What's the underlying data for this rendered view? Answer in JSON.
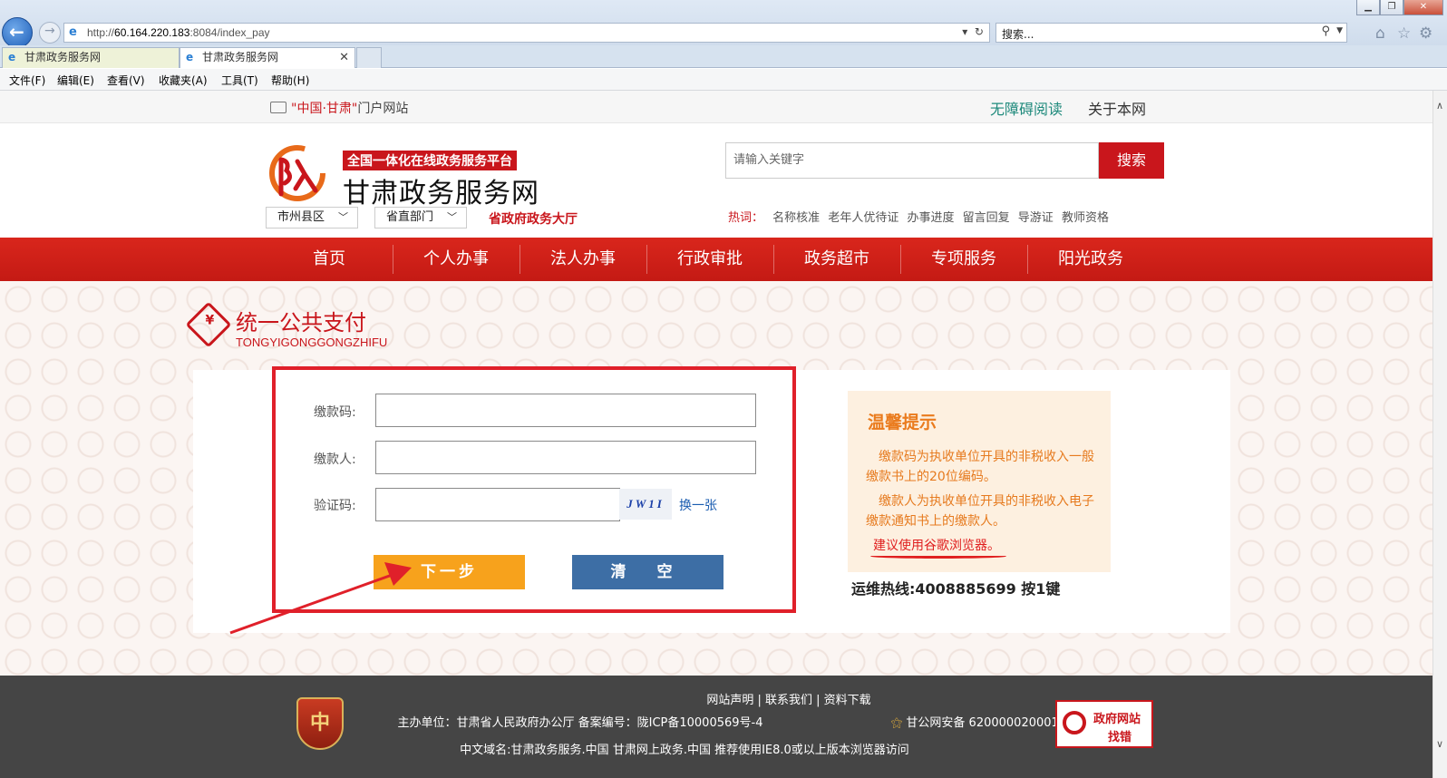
{
  "browser": {
    "url_prefix": "http://",
    "url_host": "60.164.220.183",
    "url_rest": ":8084/index_pay",
    "search_placeholder": "搜索...",
    "tabs": [
      {
        "label": "甘肃政务服务网"
      },
      {
        "label": "甘肃政务服务网"
      }
    ],
    "menu": [
      "文件(F)",
      "编辑(E)",
      "查看(V)",
      "收藏夹(A)",
      "工具(T)",
      "帮助(H)"
    ]
  },
  "topstrip": {
    "portal_quote": "\"中国·甘肃\"",
    "portal_suffix": "门户网站",
    "accessible": "无障碍阅读",
    "about": "关于本网"
  },
  "header": {
    "slogan": "全国一体化在线政务服务平台",
    "title": "甘肃政务服务网",
    "dropdown_city": "市州县区",
    "dropdown_dept": "省直部门",
    "hall_link": "省政府政务大厅",
    "search_placeholder": "请输入关键字",
    "search_button": "搜索",
    "hotwords_label": "热词：",
    "hotwords": [
      "名称核准",
      "老年人优待证",
      "办事进度",
      "留言回复",
      "导游证",
      "教师资格"
    ]
  },
  "nav": [
    "首页",
    "个人办事",
    "法人办事",
    "行政审批",
    "政务超市",
    "专项服务",
    "阳光政务"
  ],
  "pay": {
    "title": "统一公共支付",
    "subtitle": "TONGYIGONGGONGZHIFU",
    "label_code": "缴款码:",
    "label_payer": "缴款人:",
    "label_captcha": "验证码:",
    "captcha_text": "JW1I",
    "refresh": "换一张",
    "next": "下一步",
    "clear": "清 空"
  },
  "tips": {
    "title": "温馨提示",
    "tip1": "缴款码为执收单位开具的非税收入一般缴款书上的20位编码。",
    "tip2": "缴款人为执收单位开具的非税收入电子缴款通知书上的缴款人。",
    "tip3": "建议使用谷歌浏览器。",
    "hotline": "运维热线:4008885699 按1键"
  },
  "footer": {
    "emblem_char": "中",
    "links": "网站声明 | 联系我们 | 资料下载",
    "line2": "主办单位：甘肃省人民政府办公厅    备案编号：陇ICP备10000569号-4",
    "police": "甘公网安备 62000002000117号",
    "line3": "中文域名:甘肃政务服务.中国    甘肃网上政务.中国    推荐使用IE8.0或以上版本浏览器访问",
    "badge_top": "政府网站",
    "badge_bottom": "找错"
  },
  "colors": {
    "brand_red": "#c9161c",
    "next_orange": "#f7a21c",
    "clear_blue": "#3d6ea5",
    "tips_orange": "#e67a1e"
  }
}
